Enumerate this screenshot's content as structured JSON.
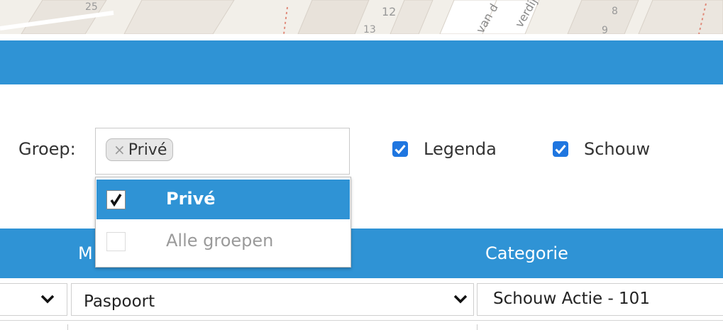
{
  "map": {
    "labels": [
      "25",
      "12",
      "13",
      "van d",
      "verdij",
      "8",
      "9"
    ]
  },
  "filters": {
    "groep_label": "Groep:",
    "selected_tag": "Privé",
    "legenda_label": "Legenda",
    "legenda_checked": true,
    "schouw_label": "Schouw",
    "schouw_checked": true
  },
  "dropdown": {
    "options": [
      {
        "label": "Privé",
        "checked": true,
        "highlighted": true
      },
      {
        "label": "Alle groepen",
        "checked": false,
        "disabled": true
      }
    ]
  },
  "table": {
    "headers": [
      "M",
      "Categorie"
    ],
    "filter_row": {
      "cell2_value": "Paspoort",
      "cell3_value": "Schouw Actie - 101"
    }
  },
  "colors": {
    "accent": "#2f93d5",
    "checkbox": "#1f76e0"
  }
}
